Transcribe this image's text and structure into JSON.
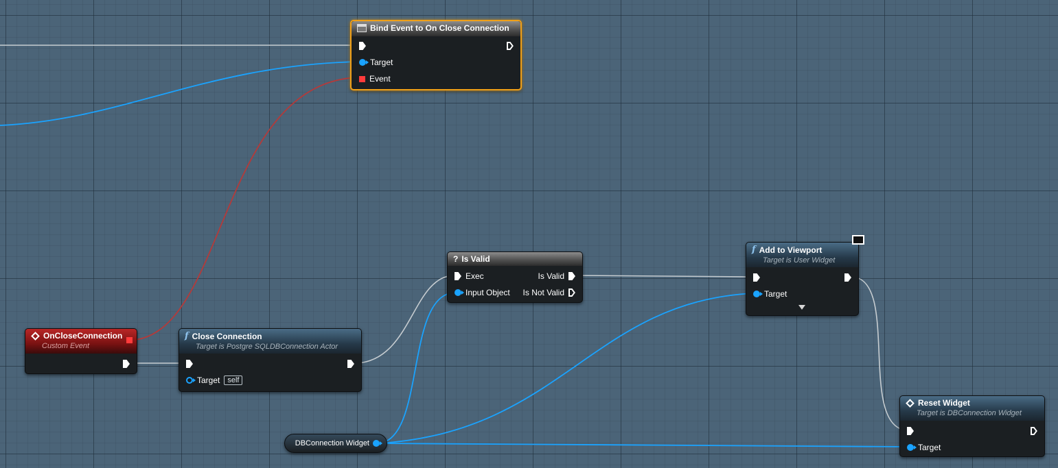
{
  "graph": {
    "colors": {
      "exec_wire": "#c7cdd1",
      "object_wire": "#1aa3ff",
      "delegate_wire": "#b43a3a",
      "selected_border": "#f0a018"
    },
    "nodes": {
      "bind_event": {
        "title": "Bind Event to On Close Connection",
        "icon": "table-icon",
        "pins": {
          "target": "Target",
          "event": "Event"
        }
      },
      "on_close_connection": {
        "title": "OnCloseConnection",
        "subtitle": "Custom Event",
        "icon": "event-icon"
      },
      "close_connection": {
        "title": "Close Connection",
        "subtitle": "Target is Postgre SQLDBConnection Actor",
        "icon": "function-icon",
        "pins": {
          "target": "Target",
          "target_default": "self"
        }
      },
      "is_valid": {
        "title": "Is Valid",
        "icon": "question-icon",
        "pins": {
          "exec": "Exec",
          "input_object": "Input Object",
          "is_valid": "Is Valid",
          "is_not_valid": "Is Not Valid"
        }
      },
      "add_to_viewport": {
        "title": "Add to Viewport",
        "subtitle": "Target is User Widget",
        "icon": "function-icon",
        "pins": {
          "target": "Target"
        }
      },
      "reset_widget": {
        "title": "Reset Widget",
        "subtitle": "Target is DBConnection Widget",
        "icon": "event-icon",
        "pins": {
          "target": "Target"
        }
      },
      "db_connection_widget": {
        "label": "DBConnection Widget"
      }
    }
  }
}
